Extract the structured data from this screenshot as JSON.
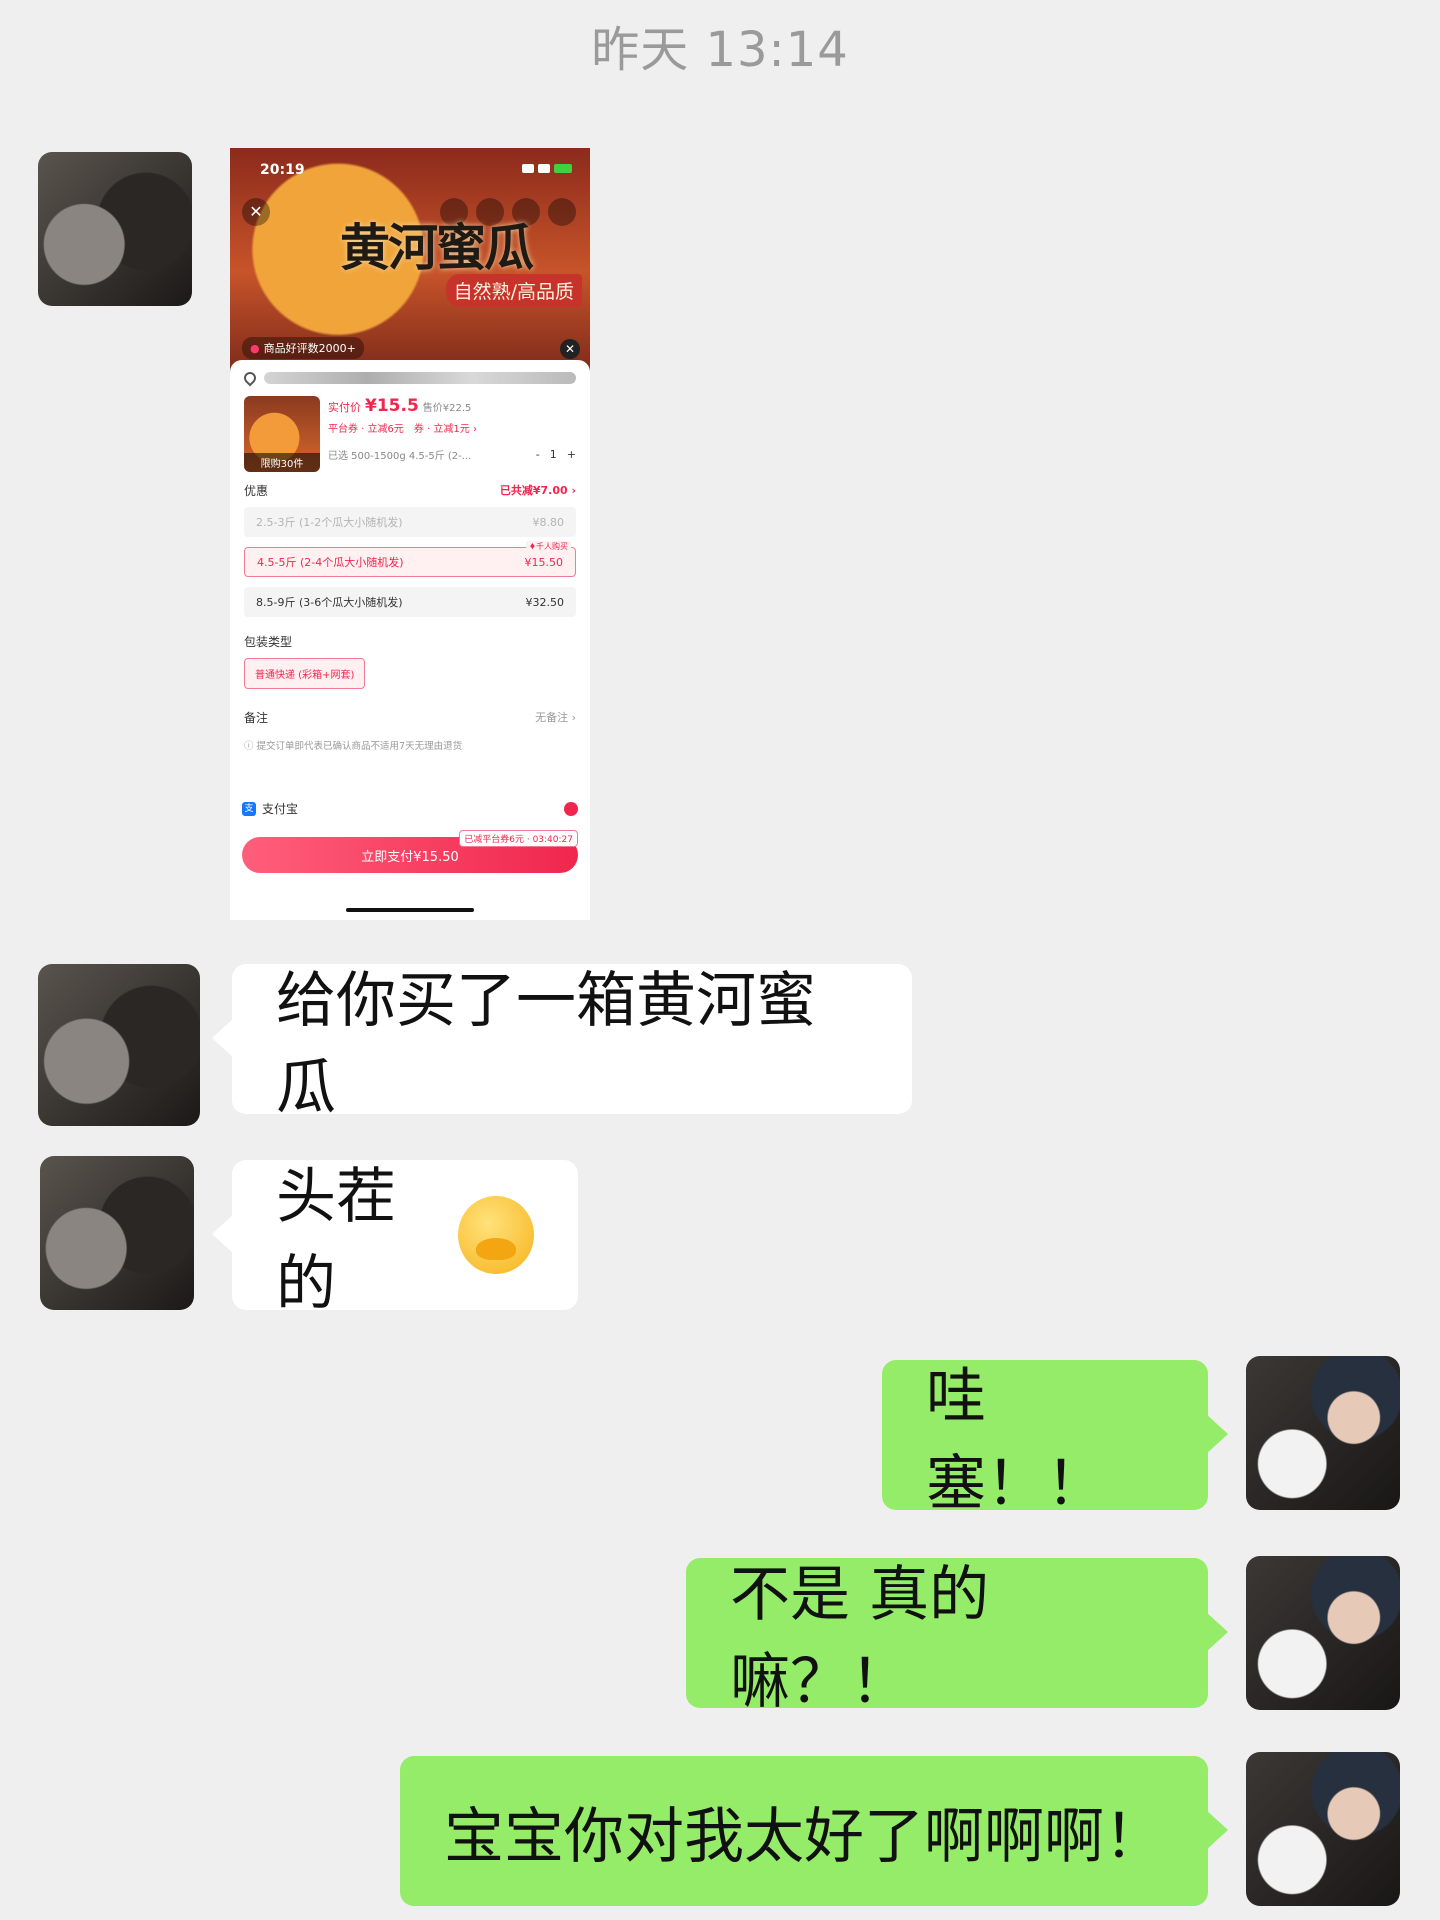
{
  "timestamp": "昨天 13:14",
  "colors": {
    "background": "#efefef",
    "incoming_bubble": "#ffffff",
    "outgoing_bubble": "#95ec69",
    "accent_red": "#f0264d"
  },
  "screenshot": {
    "status_time": "20:19",
    "hero_title": "黄河蜜瓜",
    "hero_subtitle": "自然熟/高品质",
    "reviews_badge": "商品好评数2000+",
    "product_limit": "限购30件",
    "pay_price_label": "实付价",
    "pay_price_value": "¥15.5",
    "original_price": "售价¥22.5",
    "coupon_line": "平台券 · 立减6元　券 · 立减1元 ›",
    "selected_spec": "已选 500-1500g 4.5-5斤 (2-...",
    "quantity": "1",
    "qty_minus": "-",
    "qty_plus": "+",
    "discount_label": "优惠",
    "discount_total": "已共减¥7.00 ›",
    "specs": [
      {
        "name": "2.5-3斤 (1-2个瓜大小随机发)",
        "price": "¥8.80",
        "state": "disabled"
      },
      {
        "name": "4.5-5斤 (2-4个瓜大小随机发)",
        "price": "¥15.50",
        "state": "selected",
        "badge": "♦千人购买"
      },
      {
        "name": "8.5-9斤 (3-6个瓜大小随机发)",
        "price": "¥32.50",
        "state": "normal"
      }
    ],
    "package_label": "包装类型",
    "package_option": "普通快递 (彩箱+网套)",
    "note_label": "备注",
    "note_value": "无备注 ›",
    "disclaimer": "ⓘ 提交订单即代表已确认商品不适用7天无理由退货",
    "payment_method": "支付宝",
    "alipay_glyph": "支",
    "pay_tag": "已减平台券6元 · 03:40:27",
    "pay_button": "立即支付¥15.50"
  },
  "messages": [
    {
      "from": "them",
      "text": "给你买了一箱黄河蜜瓜"
    },
    {
      "from": "them",
      "text": "头茬的",
      "emoji": "face-with-hand-over-mouth"
    },
    {
      "from": "me",
      "text": "哇塞！！"
    },
    {
      "from": "me",
      "text": "不是 真的嘛？！"
    },
    {
      "from": "me",
      "text": "宝宝你对我太好了啊啊啊！"
    }
  ]
}
